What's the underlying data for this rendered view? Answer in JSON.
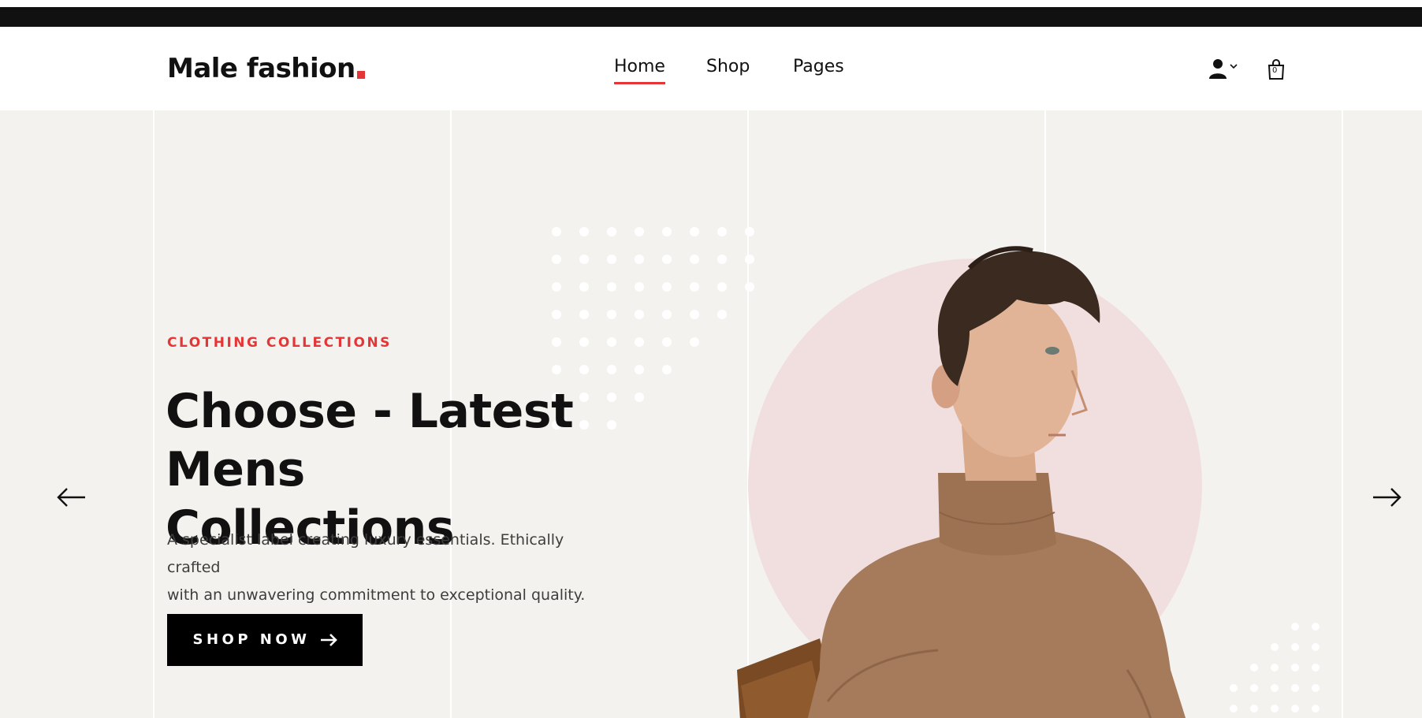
{
  "header": {
    "logo_text": "Male fashion",
    "nav": {
      "home": "Home",
      "shop": "Shop",
      "pages": "Pages"
    },
    "cart_count": "0"
  },
  "hero": {
    "label": "CLOTHING COLLECTIONS",
    "title_line1": "Choose - Latest",
    "title_line2": "Mens Collections",
    "description_line1": "A specialist label creating luxury essentials. Ethically crafted",
    "description_line2": "with an unwavering commitment to exceptional quality.",
    "button_label": "SHOP NOW"
  },
  "colors": {
    "accent": "#e53637",
    "dark": "#111111",
    "hero_background": "#f3f2ee",
    "circle": "#f1dfdf",
    "sweater": "#a57b5b"
  },
  "icons": [
    "user-icon",
    "chevron-down-icon",
    "shopping-bag-icon",
    "arrow-right-icon",
    "arrow-left-icon"
  ]
}
